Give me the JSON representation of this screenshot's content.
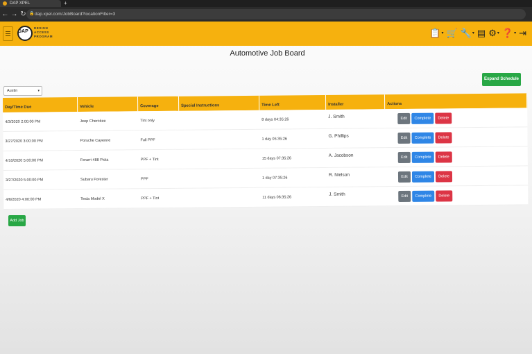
{
  "browser": {
    "tab_title": "DAP XPEL",
    "new_tab": "+",
    "url": "dap.xpel.com/JobBoard?locationFilter=3"
  },
  "header": {
    "logo_mark": "DAP",
    "logo_lines": [
      "DESIGN",
      "ACCESS",
      "PROGRAM"
    ]
  },
  "page": {
    "title": "Automotive Job Board",
    "expand_button": "Expand Schedule",
    "location_selected": "Austin",
    "add_job_button": "Add Job"
  },
  "table": {
    "columns": [
      "Day/Time Due",
      "Vehicle",
      "Coverage",
      "Special Instructions",
      "Time Left",
      "Installer",
      "Actions"
    ],
    "action_labels": {
      "edit": "Edit",
      "complete": "Complete",
      "delete": "Delete"
    },
    "rows": [
      {
        "due": "4/3/2020 2:00:00 PM",
        "vehicle": "Jeep Cherokee",
        "coverage": "Tint only",
        "instructions": "",
        "time_left": "8 days 04:35:26",
        "installer": "J. Smith"
      },
      {
        "due": "3/27/2020 3:00:00 PM",
        "vehicle": "Porsche Cayenne",
        "coverage": "Full PPF",
        "instructions": "",
        "time_left": "1 day 05:35:26",
        "installer": "G. Phillips"
      },
      {
        "due": "4/10/2020 5:00:00 PM",
        "vehicle": "Ferarri 488 Pista",
        "coverage": "PPF + Tint",
        "instructions": "",
        "time_left": "15 days 07:35:26",
        "installer": "A. Jacobson"
      },
      {
        "due": "3/27/2020 5:00:00 PM",
        "vehicle": "Subaru Forester",
        "coverage": "PPF",
        "instructions": "",
        "time_left": "1 day 07:35:26",
        "installer": "R. Nielson"
      },
      {
        "due": "4/6/2020 4:00:00 PM",
        "vehicle": "Tesla Model X",
        "coverage": "PPF + Tint",
        "instructions": "",
        "time_left": "11 days 06:35:26",
        "installer": "J. Smith"
      }
    ]
  },
  "icons": [
    "clipboard-icon",
    "cart-icon",
    "wrench-icon",
    "document-icon",
    "gear-icon",
    "help-icon",
    "logout-icon"
  ],
  "colors": {
    "accent": "#f6b10e",
    "success": "#28a745",
    "primary": "#2f86e6",
    "danger": "#dc3545",
    "secondary": "#6c757d"
  }
}
